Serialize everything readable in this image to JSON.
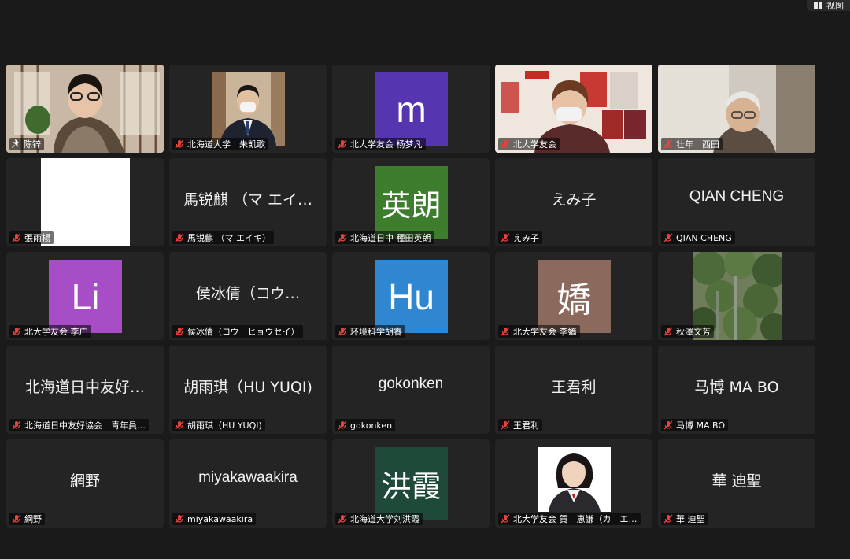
{
  "toolbar": {
    "view_label": "视图",
    "view_icon": "grid-icon"
  },
  "colors": {
    "active_border": "#7ad36a",
    "mute_icon": "#e5433c"
  },
  "tiles": [
    {
      "label": "陈锌",
      "type": "video",
      "active": true,
      "pinned": true
    },
    {
      "label": "北海道大学　朱凯歌",
      "type": "video"
    },
    {
      "label": "北大学友会 杨梦凡",
      "type": "avatar",
      "initial": "m",
      "bg": "#5636b0"
    },
    {
      "label": "北大学友会",
      "type": "video"
    },
    {
      "label": "壮年　西田",
      "type": "video"
    },
    {
      "label": "張雨楊",
      "type": "white"
    },
    {
      "label": "馬锐麒 （マ エイキ）",
      "type": "name",
      "display": "馬锐麒 （マ エイ…"
    },
    {
      "label": "北海道日中 種田英朗",
      "type": "avatar",
      "initial": "英朗",
      "bg": "#3e7d2d"
    },
    {
      "label": "えみ子",
      "type": "name",
      "display": "えみ子"
    },
    {
      "label": "QIAN CHENG",
      "type": "name",
      "display": "QIAN CHENG"
    },
    {
      "label": "北大学友会 李广",
      "type": "avatar",
      "initial": "Li",
      "bg": "#a74ec7"
    },
    {
      "label": "侯冰倩（コウ　ヒョウセイ）",
      "type": "name",
      "display": "侯冰倩（コウ…"
    },
    {
      "label": "环境科学胡睿",
      "type": "avatar",
      "initial": "Hu",
      "bg": "#2f86d1"
    },
    {
      "label": "北大学友会 李嬌",
      "type": "avatar",
      "initial": "嬌",
      "bg": "#8b6a5d"
    },
    {
      "label": "秋澤文芳",
      "type": "video"
    },
    {
      "label": "北海道日中友好協会　青年員…",
      "type": "name",
      "display": "北海道日中友好…"
    },
    {
      "label": "胡雨琪（HU YUQI)",
      "type": "name",
      "display": "胡雨琪（HU YUQI)"
    },
    {
      "label": "gokonken",
      "type": "name",
      "display": "gokonken"
    },
    {
      "label": "王君利",
      "type": "name",
      "display": "王君利"
    },
    {
      "label": "马博 MA BO",
      "type": "name",
      "display": "马博 MA BO"
    },
    {
      "label": "網野",
      "type": "name",
      "display": "網野"
    },
    {
      "label": "miyakawaakira",
      "type": "name",
      "display": "miyakawaakira"
    },
    {
      "label": "北海道大学刘洪霞",
      "type": "avatar",
      "initial": "洪霞",
      "bg": "#1f4a3a"
    },
    {
      "label": "北大学友会 賀　恵謙（カ　エ…",
      "type": "video"
    },
    {
      "label": "華 迪聖",
      "type": "name",
      "display": "華 迪聖"
    }
  ]
}
